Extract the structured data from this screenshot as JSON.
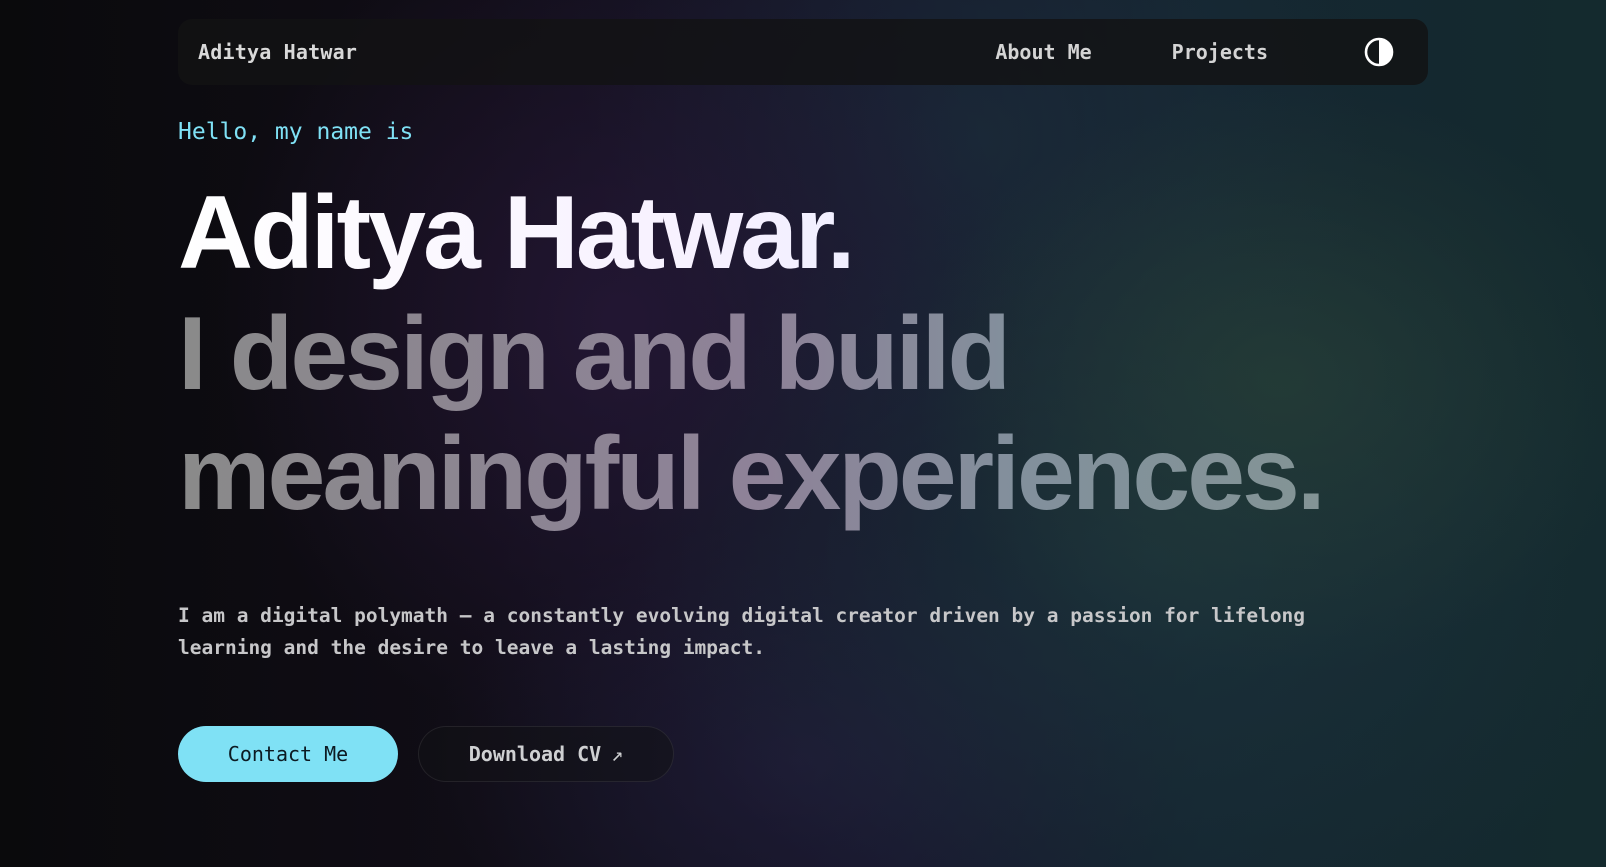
{
  "navbar": {
    "brand": "Aditya Hatwar",
    "links": [
      {
        "label": "About Me"
      },
      {
        "label": "Projects"
      }
    ],
    "theme_toggle_icon": "contrast-icon"
  },
  "hero": {
    "greeting": "Hello, my name is",
    "name": "Aditya Hatwar.",
    "tagline_line1": "I design and build",
    "tagline_line2": "meaningful experiences.",
    "intro": "I am a digital polymath — a constantly evolving digital creator driven by a passion for lifelong learning and the desire to leave a lasting impact.",
    "contact_label": "Contact Me",
    "cv_label": "Download CV",
    "cv_icon": "↗"
  },
  "colors": {
    "accent": "#7fe1f5",
    "background": "#0b0c0f",
    "navbar_bg": "#121214"
  }
}
